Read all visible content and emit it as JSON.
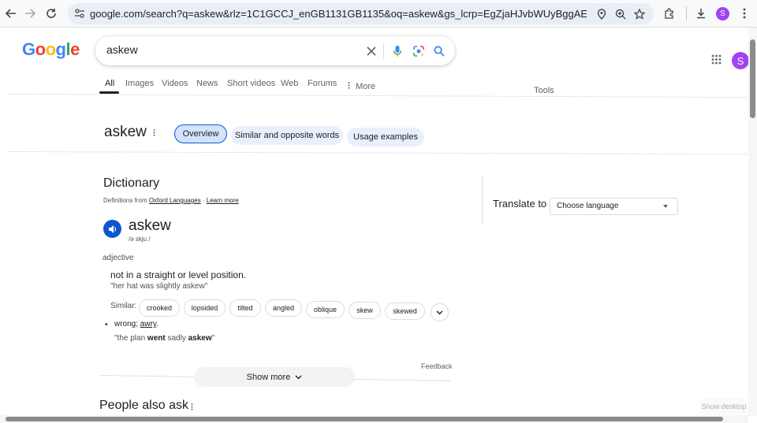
{
  "browser": {
    "url": "google.com/search?q=askew&rlz=1C1GCCJ_enGB1131GB1135&oq=askew&gs_lcrp=EgZjaHJvbWUyBggAEEUYOdIBCTEzMjlqMGoxNa...",
    "profile_initial": "S"
  },
  "google": {
    "logo_letters": [
      "G",
      "o",
      "o",
      "g",
      "l",
      "e"
    ],
    "logo_colors": [
      "#4285F4",
      "#EA4335",
      "#FBBC05",
      "#4285F4",
      "#34A853",
      "#EA4335"
    ],
    "query": "askew",
    "account_initial": "S",
    "tabs": [
      "All",
      "Images",
      "Videos",
      "News",
      "Short videos",
      "Web",
      "Forums",
      "More"
    ],
    "tools_label": "Tools"
  },
  "term_header": {
    "term": "askew",
    "chips": [
      "Overview",
      "Similar and opposite words",
      "Usage examples"
    ]
  },
  "dictionary": {
    "title": "Dictionary",
    "defs_from_prefix": "Definitions from",
    "source": "Oxford Languages",
    "learn_more": "Learn more",
    "word": "askew",
    "phonetic": "/ə skju /",
    "part_of_speech": "adjective",
    "definition_1": "not in a straight or level position.",
    "example_1": "\"her hat was slightly askew\"",
    "similar_label": "Similar:",
    "similar": [
      "crooked",
      "lopsided",
      "tilted",
      "angled",
      "oblique",
      "skew",
      "skewed"
    ],
    "definition_2_prefix": "wrong;",
    "definition_2_link": "awry",
    "definition_2_suffix": ".",
    "example_2_pre": "\"the plan",
    "example_2_bold1": "went",
    "example_2_mid": "sadly",
    "example_2_bold2": "askew",
    "example_2_post": "\"",
    "feedback": "Feedback",
    "show_more": "Show more"
  },
  "people_also_ask": "People also ask",
  "translate": {
    "label": "Translate to",
    "placeholder": "Choose language"
  },
  "overlay": {
    "show_desktop": "Show desktop"
  },
  "colors": {
    "accent_blue": "#0b57d0",
    "chip_bg": "#e8f0fe",
    "profile_purple": "#a142f4"
  }
}
